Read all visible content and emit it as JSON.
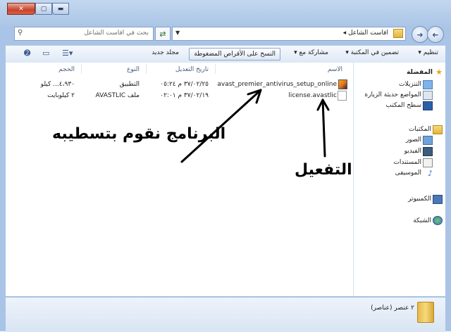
{
  "window": {
    "close_label": "✕",
    "maximize_label": "▢",
    "minimize_label": "▬"
  },
  "nav_bar": {
    "back_icon": "back-arrow-icon",
    "forward_icon": "forward-arrow-icon",
    "address": "افاست الشاعل ◂",
    "search_placeholder": "بحث في افاست الشاعل",
    "refresh_icon": "refresh-arrows-icon"
  },
  "toolbar": {
    "organize": "تنظيم ▾",
    "include_library": "تضمين في المكتبة ▾",
    "share": "مشاركة مع ▾",
    "burn": "النسخ على الأقراص المضغوطة",
    "new_folder": "مجلد جديد"
  },
  "sidebar": {
    "favorites": "المفضلة",
    "favorites_items": [
      "التنزيلات",
      "المواضع حديثة الزيارة",
      "سطح المكتب"
    ],
    "libraries": "المكتبات",
    "libraries_items": [
      "الصور",
      "الفيديو",
      "المستندات",
      "الموسيقى"
    ],
    "computer": "الكمبيوتر",
    "network": "الشبكة"
  },
  "columns": {
    "name": "الاسم",
    "modified": "تاريخ التعديل",
    "type": "النوع",
    "size": "الحجم"
  },
  "files": [
    {
      "name": "avast_premier_antivirus_setup_online",
      "modified": "٣٧/٠٢/٢٥ م ٠٥:٢٤",
      "type": "التطبيق",
      "size": "٤،٩٣٠... كيلو"
    },
    {
      "name": "license.avastlic",
      "modified": "٣٧/٠٢/١٩ م ٠٢:٠١",
      "type": "ملف AVASTLIC",
      "size": "٢ كيلوبايت"
    }
  ],
  "status": {
    "count": "٢ عنصر (عناصر)"
  },
  "annotations": {
    "program": "البرنامج نقوم بتسطيبه",
    "activation": "التفعيل"
  }
}
